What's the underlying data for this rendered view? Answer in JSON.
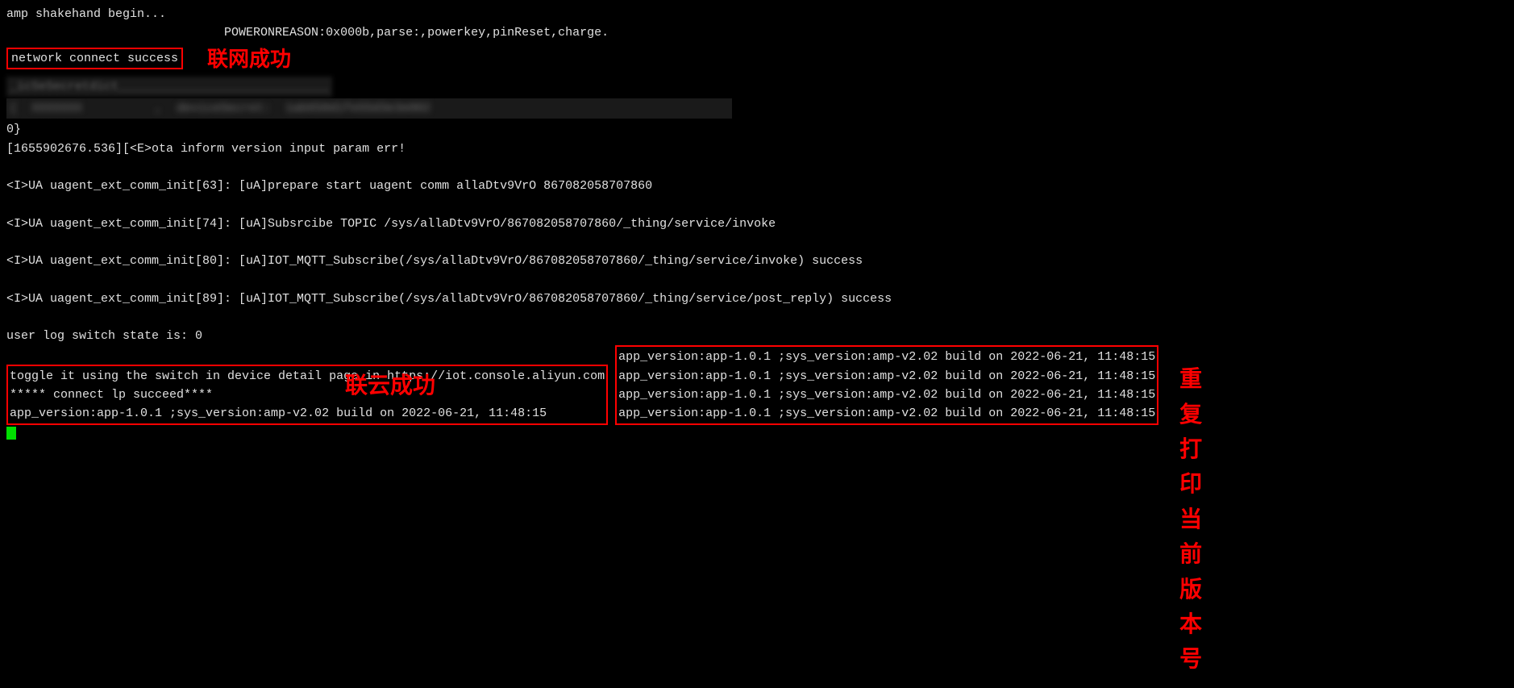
{
  "terminal": {
    "lines": [
      {
        "id": "line1",
        "text": "amp shakehand begin...",
        "color": "white"
      },
      {
        "id": "line2",
        "text": "                              POWERONREASON:0x000b,parse:,powerkey,pinReset,charge.",
        "color": "white"
      },
      {
        "id": "line3_network",
        "text": "network connect success",
        "color": "white",
        "boxed": true
      },
      {
        "id": "line3_blurred",
        "text": "    [REDACTED]",
        "color": "dim"
      },
      {
        "id": "line4_blurred",
        "text": "[REDACTED SECRET DICT]",
        "color": "dim"
      },
      {
        "id": "line5_blurred2",
        "text": "{  [REDACTED]   ,  deviceSecret:  [REDACTED LONG STRING]                                                                       c':",
        "color": "dim"
      },
      {
        "id": "line6",
        "text": "0}",
        "color": "white"
      },
      {
        "id": "line7",
        "text": "[1655902676.536][<E>ota inform version input param err!",
        "color": "white"
      },
      {
        "id": "line8",
        "text": "",
        "color": "white"
      },
      {
        "id": "line9",
        "text": "<I>UA uagent_ext_comm_init[63]: [uA]prepare start uagent comm allaDtv9VrO 867082058707860",
        "color": "white"
      },
      {
        "id": "line10",
        "text": "",
        "color": "white"
      },
      {
        "id": "line11",
        "text": "<I>UA uagent_ext_comm_init[74]: [uA]Subsrcibe TOPIC /sys/allaDtv9VrO/867082058707860/_thing/service/invoke",
        "color": "white"
      },
      {
        "id": "line12",
        "text": "",
        "color": "white"
      },
      {
        "id": "line13",
        "text": "<I>UA uagent_ext_comm_init[80]: [uA]IOT_MQTT_Subscribe(/sys/allaDtv9VrO/867082058707860/_thing/service/invoke) success",
        "color": "white"
      },
      {
        "id": "line14",
        "text": "",
        "color": "white"
      },
      {
        "id": "line15",
        "text": "<I>UA uagent_ext_comm_init[89]: [uA]IOT_MQTT_Subscribe(/sys/allaDtv9VrO/867082058707860/_thing/service/post_reply) success",
        "color": "white"
      },
      {
        "id": "line16",
        "text": "",
        "color": "white"
      },
      {
        "id": "line17",
        "text": "user log switch state is: 0",
        "color": "white"
      },
      {
        "id": "line18",
        "text": "toggle it using the switch in device detail page in https://iot.console.aliyun.com",
        "color": "white"
      },
      {
        "id": "line19",
        "text": "***** connect lp succeed****",
        "color": "white"
      },
      {
        "id": "line20",
        "text": "app_version:app-1.0.1 ;sys_version:amp-v2.02 build on 2022-06-21, 11:48:15",
        "color": "white"
      },
      {
        "id": "line21",
        "text": "app_version:app-1.0.1 ;sys_version:amp-v2.02 build on 2022-06-21, 11:48:15",
        "color": "white"
      },
      {
        "id": "line22",
        "text": "app_version:app-1.0.1 ;sys_version:amp-v2.02 build on 2022-06-21, 11:48:15",
        "color": "white"
      },
      {
        "id": "line23",
        "text": "app_version:app-1.0.1 ;sys_version:amp-v2.02 build on 2022-06-21, 11:48:15",
        "color": "white"
      },
      {
        "id": "line24",
        "text": "app_version:app-1.0.1 ;sys_version:amp-v2.02 build on 2022-06-21, 11:48:15",
        "color": "white"
      },
      {
        "id": "line25_green",
        "text": "■",
        "color": "green"
      }
    ],
    "annotations": [
      {
        "id": "ann1",
        "text": "联网成功"
      },
      {
        "id": "ann2",
        "text": "联云成功"
      },
      {
        "id": "ann3",
        "text": "重复打印当前版本号"
      }
    ]
  }
}
